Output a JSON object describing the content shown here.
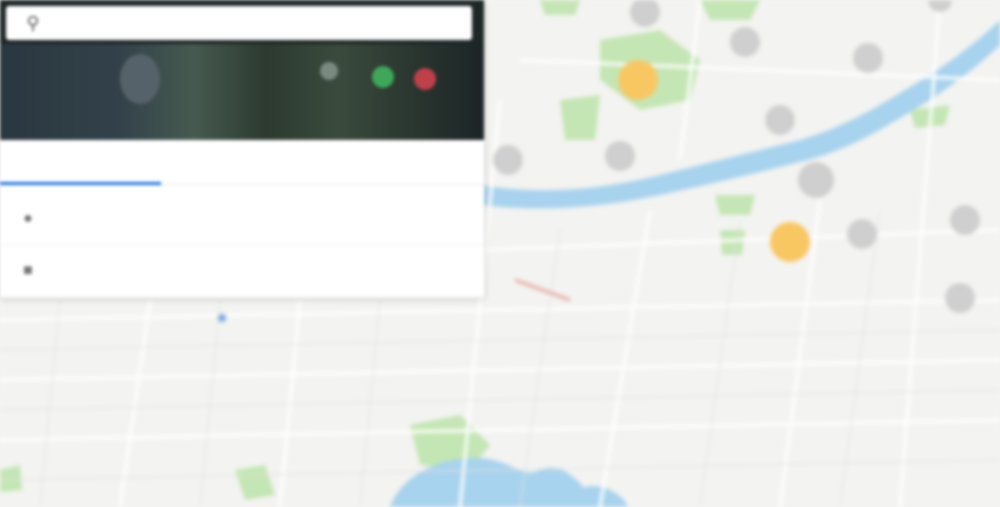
{
  "search": {
    "placeholder": "",
    "value": "",
    "icon": "search-icon"
  },
  "header": {
    "caption": [
      "",
      "",
      "",
      "",
      ""
    ]
  },
  "tabs": [
    {
      "label": "",
      "active": true
    },
    {
      "label": "",
      "active": false
    },
    {
      "label": "",
      "active": false
    }
  ],
  "results": [
    {
      "icon": "pin-icon",
      "title": "",
      "subtitle": ""
    },
    {
      "icon": "building-icon",
      "title": "",
      "subtitle": ""
    }
  ],
  "map": {
    "colors": {
      "land": "#f3f3f1",
      "road": "#ffffff",
      "water": "#a8d3ee",
      "park": "#c4e6b4",
      "poi": "#f9c762",
      "poi_gray": "#c9c9c9"
    },
    "labels": []
  }
}
